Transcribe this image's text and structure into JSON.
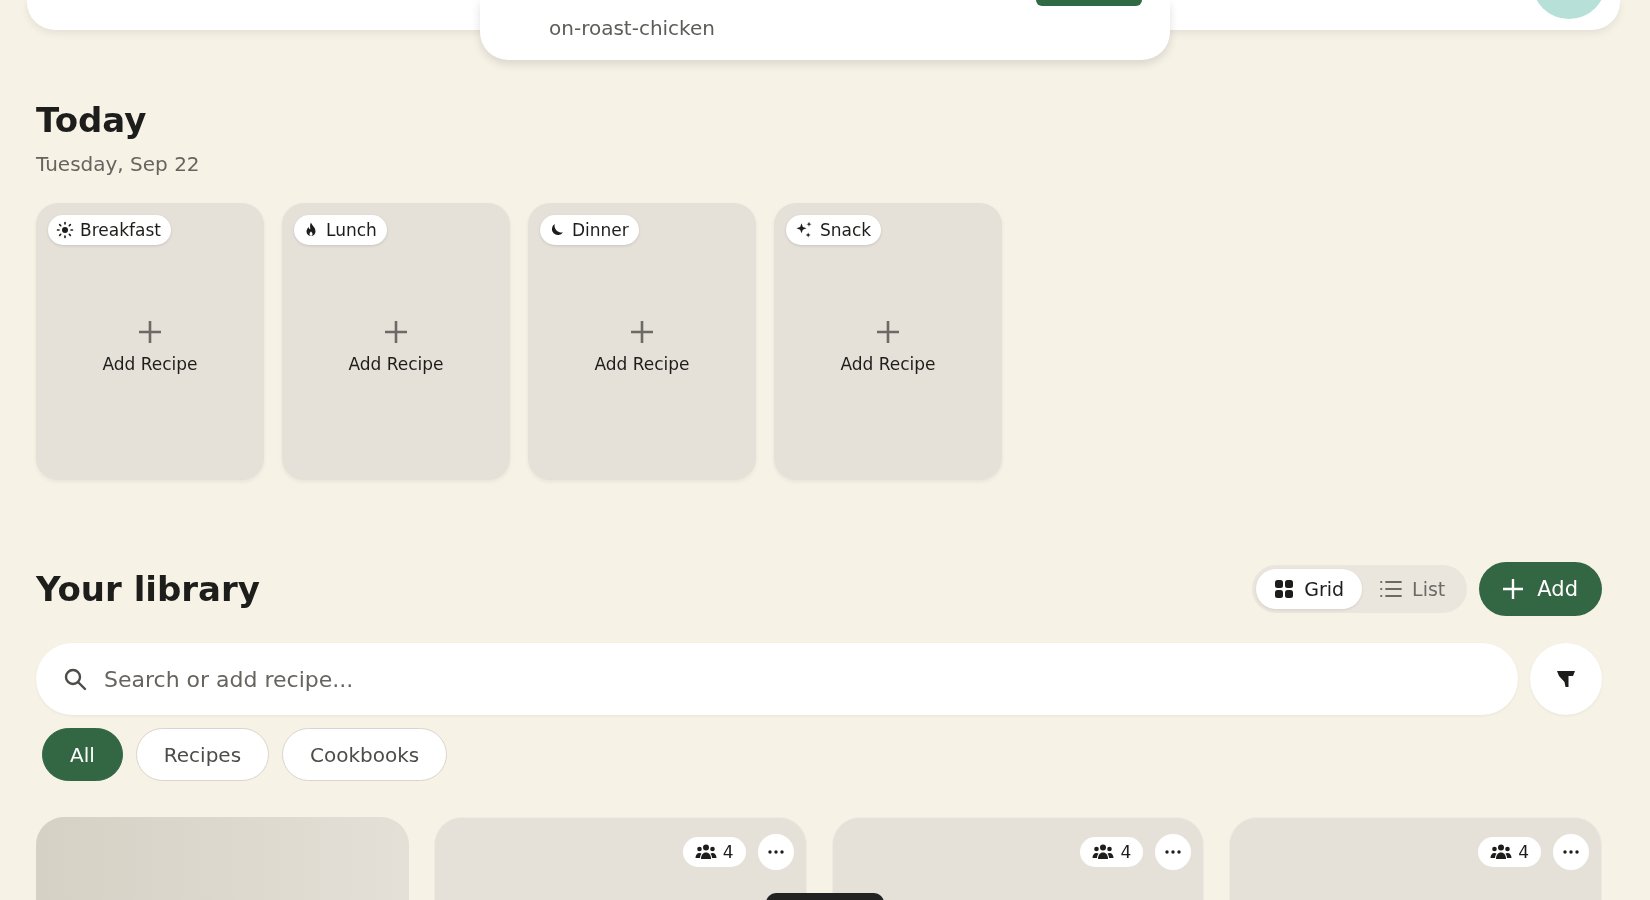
{
  "header": {
    "url_popover": {
      "text": "on-roast-chicken"
    }
  },
  "today": {
    "title": "Today",
    "date": "Tuesday, Sep 22",
    "meals": [
      {
        "kind": "breakfast",
        "label": "Breakfast",
        "action": "Add Recipe"
      },
      {
        "kind": "lunch",
        "label": "Lunch",
        "action": "Add Recipe"
      },
      {
        "kind": "dinner",
        "label": "Dinner",
        "action": "Add Recipe"
      },
      {
        "kind": "snack",
        "label": "Snack",
        "action": "Add Recipe"
      }
    ]
  },
  "library": {
    "title": "Your library",
    "views": [
      {
        "kind": "grid",
        "label": "Grid",
        "selected": true
      },
      {
        "kind": "list",
        "label": "List",
        "selected": false
      }
    ],
    "add_button": "Add",
    "search": {
      "placeholder": "Search or add recipe..."
    },
    "filters": [
      {
        "label": "All",
        "selected": true
      },
      {
        "label": "Recipes",
        "selected": false
      },
      {
        "label": "Cookbooks",
        "selected": false
      }
    ],
    "cards": [
      {
        "kind": "loading"
      },
      {
        "kind": "recipe",
        "servings": "4"
      },
      {
        "kind": "recipe",
        "servings": "4"
      },
      {
        "kind": "recipe",
        "servings": "4"
      }
    ]
  }
}
